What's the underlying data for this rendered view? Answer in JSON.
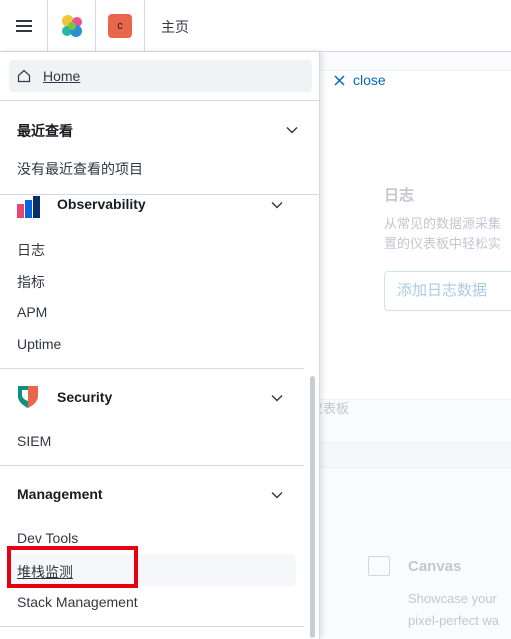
{
  "header": {
    "space_initial": "c",
    "breadcrumb": "主页"
  },
  "nav": {
    "home_label": "Home",
    "recent": {
      "title": "最近查看",
      "empty_text": "没有最近查看的项目"
    },
    "observability": {
      "title": "Observability",
      "items": [
        "日志",
        "指标",
        "APM",
        "Uptime"
      ]
    },
    "security": {
      "title": "Security",
      "items": [
        "SIEM"
      ]
    },
    "management": {
      "title": "Management",
      "items": [
        "Dev Tools",
        "堆栈监测",
        "Stack Management"
      ]
    }
  },
  "background": {
    "close_label": "close",
    "logs_title": "日志",
    "logs_desc_line1": "从常见的数据源采集",
    "logs_desc_line2": "置的仪表板中轻松实",
    "add_logs_button": "添加日志数据",
    "dashboard_link": "仪表板",
    "canvas_title": "Canvas",
    "canvas_desc_line1": "Showcase your",
    "canvas_desc_line2": "pixel-perfect wa"
  },
  "colors": {
    "accent": "#006bb8",
    "highlight_box": "#e60012",
    "space_avatar": "#e7664c"
  }
}
